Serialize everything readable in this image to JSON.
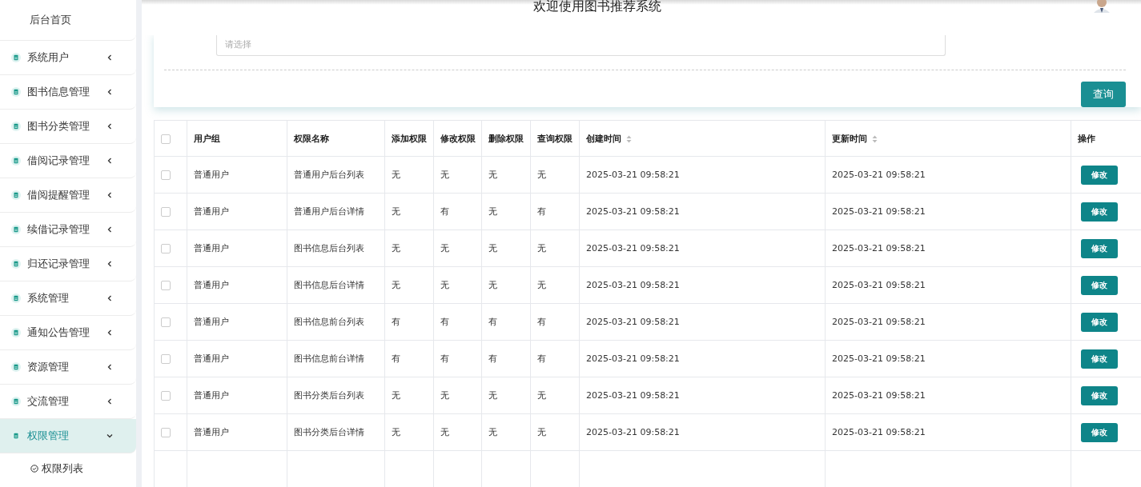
{
  "header": {
    "title": "欢迎使用图书推荐系统"
  },
  "sidebar": {
    "items": [
      {
        "label": "后台首页",
        "kind": "home",
        "selected": false
      },
      {
        "label": "系统用户",
        "kind": "menu",
        "selected": false,
        "expanded": false
      },
      {
        "label": "图书信息管理",
        "kind": "menu",
        "selected": false,
        "expanded": false
      },
      {
        "label": "图书分类管理",
        "kind": "menu",
        "selected": false,
        "expanded": false
      },
      {
        "label": "借阅记录管理",
        "kind": "menu",
        "selected": false,
        "expanded": false
      },
      {
        "label": "借阅提醒管理",
        "kind": "menu",
        "selected": false,
        "expanded": false
      },
      {
        "label": "续借记录管理",
        "kind": "menu",
        "selected": false,
        "expanded": false
      },
      {
        "label": "归还记录管理",
        "kind": "menu",
        "selected": false,
        "expanded": false
      },
      {
        "label": "系统管理",
        "kind": "menu",
        "selected": false,
        "expanded": false
      },
      {
        "label": "通知公告管理",
        "kind": "menu",
        "selected": false,
        "expanded": false
      },
      {
        "label": "资源管理",
        "kind": "menu",
        "selected": false,
        "expanded": false
      },
      {
        "label": "交流管理",
        "kind": "menu",
        "selected": false,
        "expanded": false
      },
      {
        "label": "权限管理",
        "kind": "menu",
        "selected": true,
        "expanded": true,
        "children": [
          {
            "label": "权限列表"
          }
        ]
      }
    ]
  },
  "search": {
    "placeholder": "请选择",
    "button": "查询"
  },
  "table": {
    "columns": [
      {
        "label": "用户组",
        "sortable": false
      },
      {
        "label": "权限名称",
        "sortable": false
      },
      {
        "label": "添加权限",
        "sortable": false
      },
      {
        "label": "修改权限",
        "sortable": false
      },
      {
        "label": "删除权限",
        "sortable": false
      },
      {
        "label": "查询权限",
        "sortable": false
      },
      {
        "label": "创建时间",
        "sortable": true
      },
      {
        "label": "更新时间",
        "sortable": true
      },
      {
        "label": "操作",
        "sortable": false
      }
    ],
    "select_all": {
      "checked": false
    },
    "rows": [
      {
        "checked": false,
        "cells": [
          "普通用户",
          "普通用户后台列表",
          "无",
          "无",
          "无",
          "无",
          "2025-03-21 09:58:21",
          "2025-03-21 09:58:21"
        ],
        "action": "修改"
      },
      {
        "checked": false,
        "cells": [
          "普通用户",
          "普通用户后台详情",
          "无",
          "有",
          "无",
          "有",
          "2025-03-21 09:58:21",
          "2025-03-21 09:58:21"
        ],
        "action": "修改"
      },
      {
        "checked": false,
        "cells": [
          "普通用户",
          "图书信息后台列表",
          "无",
          "无",
          "无",
          "无",
          "2025-03-21 09:58:21",
          "2025-03-21 09:58:21"
        ],
        "action": "修改"
      },
      {
        "checked": false,
        "cells": [
          "普通用户",
          "图书信息后台详情",
          "无",
          "无",
          "无",
          "无",
          "2025-03-21 09:58:21",
          "2025-03-21 09:58:21"
        ],
        "action": "修改"
      },
      {
        "checked": false,
        "cells": [
          "普通用户",
          "图书信息前台列表",
          "有",
          "有",
          "有",
          "有",
          "2025-03-21 09:58:21",
          "2025-03-21 09:58:21"
        ],
        "action": "修改"
      },
      {
        "checked": false,
        "cells": [
          "普通用户",
          "图书信息前台详情",
          "有",
          "有",
          "有",
          "有",
          "2025-03-21 09:58:21",
          "2025-03-21 09:58:21"
        ],
        "action": "修改"
      },
      {
        "checked": false,
        "cells": [
          "普通用户",
          "图书分类后台列表",
          "无",
          "无",
          "无",
          "无",
          "2025-03-21 09:58:21",
          "2025-03-21 09:58:21"
        ],
        "action": "修改"
      },
      {
        "checked": false,
        "cells": [
          "普通用户",
          "图书分类后台详情",
          "无",
          "无",
          "无",
          "无",
          "2025-03-21 09:58:21",
          "2025-03-21 09:58:21"
        ],
        "action": "修改"
      }
    ]
  }
}
